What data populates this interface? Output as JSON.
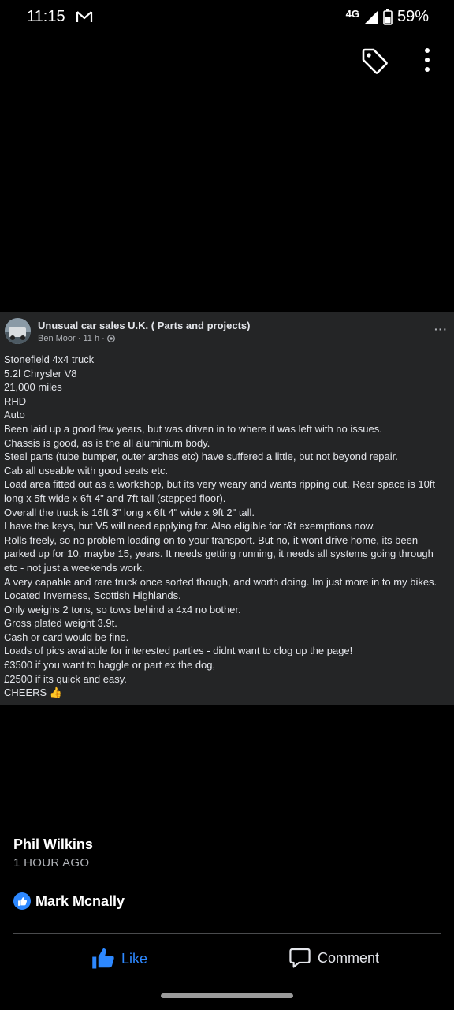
{
  "status_bar": {
    "time": "11:15",
    "network": "4G",
    "battery": "59%",
    "mail_icon": "gmail-icon"
  },
  "actions": {
    "tag_icon": "tag-icon",
    "more_icon": "more-vertical-icon"
  },
  "post": {
    "group": "Unusual car sales U.K. ( Parts and projects)",
    "meta": "Ben Moor · 11 h ·",
    "lines": [
      "Stonefield 4x4 truck",
      "5.2l Chrysler V8",
      "21,000 miles",
      "RHD",
      "Auto",
      "Been laid up a good few years, but was driven in to where it was left with no issues.",
      "Chassis is good, as is the all aluminium body.",
      "Steel parts (tube bumper, outer arches etc) have suffered a little, but not beyond repair.",
      "Cab all useable with good seats etc.",
      "Load area fitted out as a workshop, but its very weary and wants ripping out. Rear space is 10ft",
      "long x 5ft wide x 6ft 4\" and 7ft tall (stepped floor).",
      "Overall the truck is 16ft 3\" long x 6ft 4\" wide x 9ft 2\" tall.",
      "I have the keys, but V5 will need applying for. Also eligible for t&t exemptions now.",
      "Rolls freely, so no problem loading on to your transport. But no, it wont drive home, its been",
      "parked up for 10, maybe 15, years. It needs getting running, it needs all systems going through",
      "etc - not just a weekends work.",
      "A very capable and rare truck once sorted though, and worth doing. Im just more in to my bikes.",
      "Located Inverness, Scottish Highlands.",
      "Only weighs 2 tons, so tows behind a 4x4 no bother.",
      "Gross plated weight 3.9t.",
      "Cash or card would be fine.",
      "Loads of pics available for interested parties - didnt want to clog up the page!",
      "£3500 if you want to haggle or part ex the dog,",
      "£2500 if its quick and easy.",
      "CHEERS 👍"
    ]
  },
  "comment": {
    "author": "Phil Wilkins",
    "time": "1 HOUR AGO",
    "liked_by": "Mark Mcnally"
  },
  "footer": {
    "like_label": "Like",
    "comment_label": "Comment"
  },
  "colors": {
    "accent": "#2d88ff",
    "post_bg": "#242526",
    "page_bg": "#000000"
  }
}
